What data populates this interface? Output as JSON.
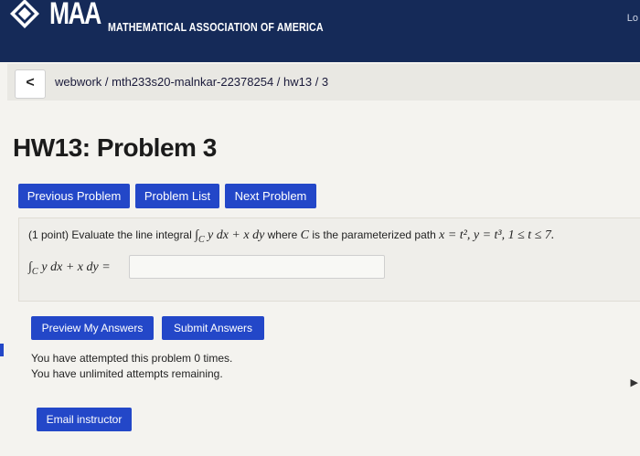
{
  "header": {
    "logo_text": "MAA",
    "org_name": "MATHEMATICAL ASSOCIATION OF AMERICA",
    "login_text": "Lo"
  },
  "breadcrumb": {
    "back_symbol": "<",
    "path": "webwork / mth233s20-malnkar-22378254 / hw13 / 3"
  },
  "page_title": "HW13: Problem 3",
  "nav_buttons": {
    "previous": "Previous Problem",
    "list": "Problem List",
    "next": "Next Problem"
  },
  "problem": {
    "points": "(1 point) Evaluate the line integral",
    "integral": "∫",
    "integral_sub": "C",
    "integrand": "y dx + x dy",
    "where_text": "where",
    "curve": "C",
    "path_text": "is the parameterized path",
    "path_eq": "x = t², y = t³, 1 ≤ t ≤ 7.",
    "answer_label": "y dx + x dy =",
    "answer_value": ""
  },
  "actions": {
    "preview": "Preview My Answers",
    "submit": "Submit Answers"
  },
  "status": {
    "line1": "You have attempted this problem 0 times.",
    "line2": "You have unlimited attempts remaining."
  },
  "footer": {
    "email": "Email instructor"
  },
  "colors": {
    "header_bg": "#152a58",
    "button_bg": "#2347c8"
  }
}
